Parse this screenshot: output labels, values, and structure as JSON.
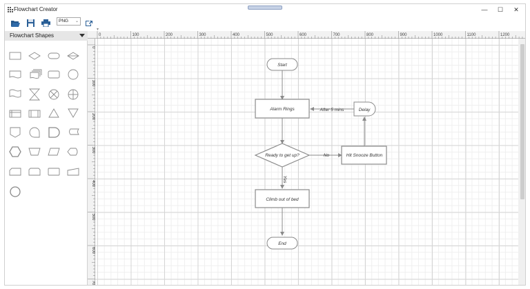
{
  "window": {
    "title": "Flowchart Creator",
    "controls": {
      "minimize": "—",
      "maximize": "☐",
      "close": "✕"
    }
  },
  "toolbar": {
    "buttons": [
      "open-icon",
      "save-icon",
      "print-icon",
      "export-icon"
    ],
    "format_selected": "PNG"
  },
  "sidebar": {
    "title": "Flowchart Shapes",
    "shapes": [
      "process",
      "decision",
      "terminator",
      "sort",
      "document",
      "multi-document",
      "predefined-process",
      "circle",
      "punched-tape",
      "collate",
      "or",
      "summing-junction",
      "internal-storage",
      "data-process",
      "extract",
      "merge",
      "off-page-reference",
      "sequential-data",
      "delay",
      "stored-data",
      "preparation",
      "manual-operation",
      "data",
      "display",
      "card",
      "manual-input",
      "loop-limit",
      "manual-input-slant",
      "connector"
    ]
  },
  "rulers": {
    "horizontal": [
      "0",
      "100",
      "200",
      "300",
      "400",
      "500",
      "600",
      "700",
      "800",
      "900",
      "1000",
      "1100",
      "1200"
    ],
    "vertical": [
      "0",
      "100",
      "200",
      "300",
      "400",
      "500",
      "600",
      "700"
    ]
  },
  "diagram": {
    "nodes": {
      "start": "Start",
      "alarm": "Alarm Rings",
      "delay": "Delay",
      "decision": "Ready to get up?",
      "snooze": "Hit Snooze Button",
      "climb": "Climb out of bed",
      "end": "End"
    },
    "edge_labels": {
      "no": "No",
      "yes": "Yes",
      "after": "After 5 mins"
    }
  },
  "colors": {
    "shape_stroke": "#8a8a8a",
    "connector": "#8a8a8a",
    "node_fill": "#ffffff",
    "scroll_accent": "#8d9fc1"
  }
}
